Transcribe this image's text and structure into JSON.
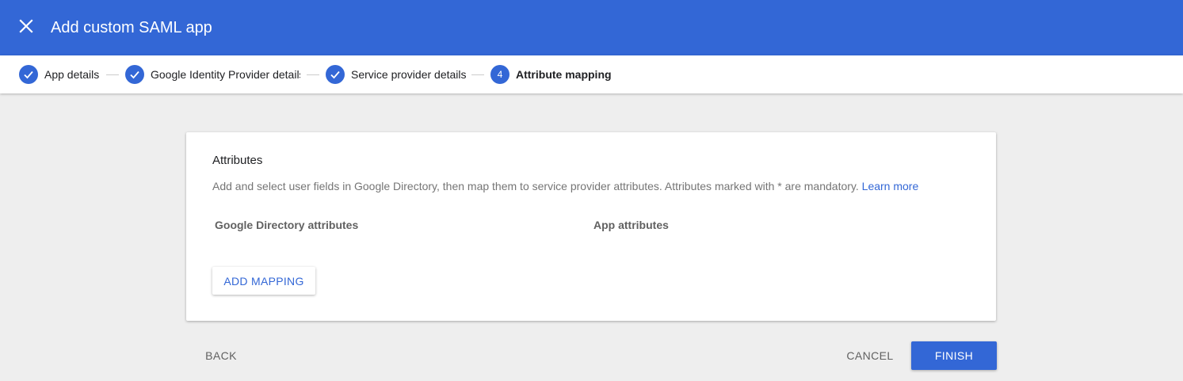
{
  "header": {
    "title": "Add custom SAML app",
    "close_icon": "close-icon",
    "color": "#3367d6"
  },
  "stepper": {
    "steps": [
      {
        "label": "App details",
        "status": "done",
        "icon": "check-icon"
      },
      {
        "label": "Google Identity Provider details",
        "status": "done",
        "icon": "check-icon"
      },
      {
        "label": "Service provider details",
        "status": "done",
        "icon": "check-icon"
      },
      {
        "label": "Attribute mapping",
        "status": "active",
        "number": "4"
      }
    ]
  },
  "card": {
    "title": "Attributes",
    "description": "Add and select user fields in Google Directory, then map them to service provider attributes. Attributes marked with * are mandatory.",
    "learn_more": "Learn more",
    "columns": [
      "Google Directory attributes",
      "App attributes"
    ],
    "add_mapping_label": "ADD MAPPING"
  },
  "footer": {
    "back_label": "BACK",
    "cancel_label": "CANCEL",
    "finish_label": "FINISH"
  }
}
